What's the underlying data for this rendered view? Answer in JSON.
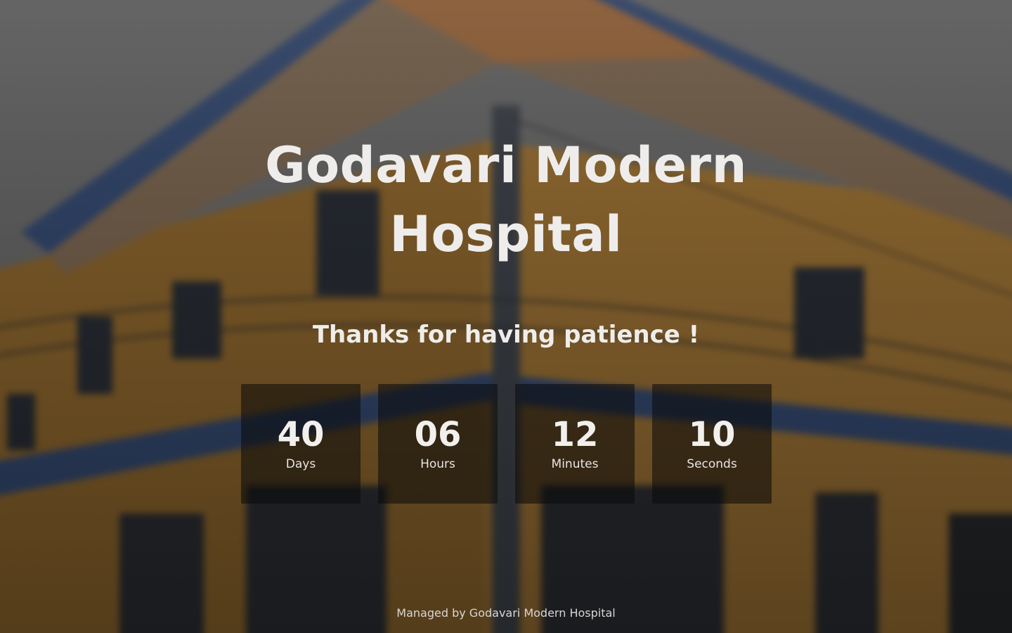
{
  "page": {
    "title": "Godavari Modern Hospital",
    "subtitle": "Thanks for having patience !",
    "footer": "Managed by Godavari Modern Hospital"
  },
  "countdown": [
    {
      "value": "40",
      "label": "Days"
    },
    {
      "value": "06",
      "label": "Hours"
    },
    {
      "value": "12",
      "label": "Minutes"
    },
    {
      "value": "10",
      "label": "Seconds"
    }
  ],
  "colors": {
    "text": "#efedeb",
    "box_bg": "rgba(10,10,10,0.55)",
    "building_wall": "#c98a2e",
    "roof_trim": "#2f4f8a",
    "sky": "#8a8a8a"
  }
}
